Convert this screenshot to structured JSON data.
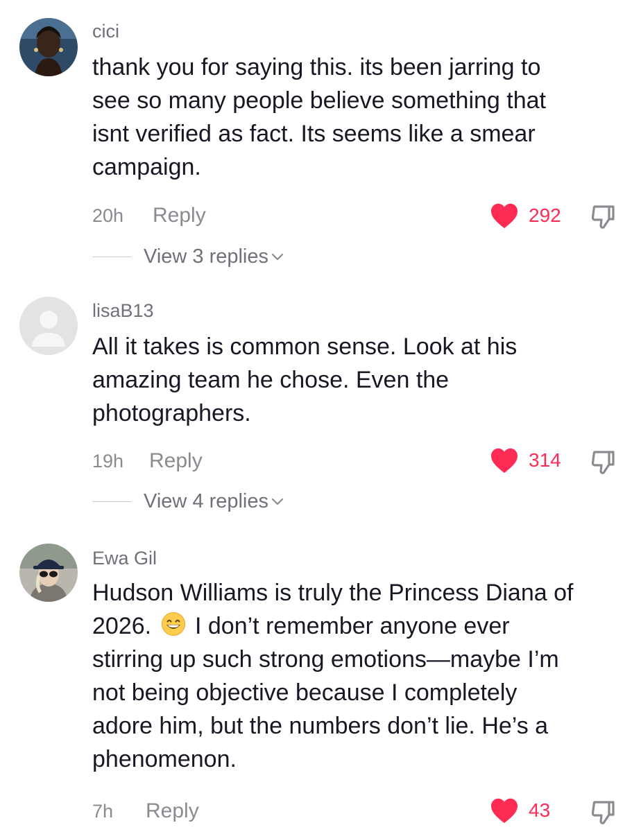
{
  "comments": [
    {
      "username": "cici",
      "lines": [
        "thank you for saying this. its been jarring to",
        "see so many people believe something that",
        "isnt verified as fact. Its seems like a smear",
        "campaign."
      ],
      "time": "20h",
      "reply_label": "Reply",
      "likes": "292",
      "view_replies": "View 3 replies"
    },
    {
      "username": "lisaB13",
      "lines": [
        "All it takes is common sense. Look at his",
        "amazing team he chose. Even the",
        "photographers."
      ],
      "time": "19h",
      "reply_label": "Reply",
      "likes": "314",
      "view_replies": "View 4 replies"
    },
    {
      "username": "Ewa Gil",
      "lines": [
        "Hudson Williams is truly the Princess Diana of",
        "2026.",
        "I don’t remember anyone ever",
        "stirring up such strong emotions—maybe I’m",
        "not being objective because I completely",
        "adore him, but the numbers don’t lie. He’s a",
        "phenomenon."
      ],
      "time": "7h",
      "reply_label": "Reply",
      "likes": "43"
    }
  ],
  "icons": {
    "like": "heart-icon",
    "dislike": "dislike-icon",
    "chevron": "chevron-down-icon",
    "emoji": "grinning-face-emoji"
  },
  "colors": {
    "like": "#fe2c55",
    "text": "#161823",
    "muted": "#8a8b91"
  }
}
